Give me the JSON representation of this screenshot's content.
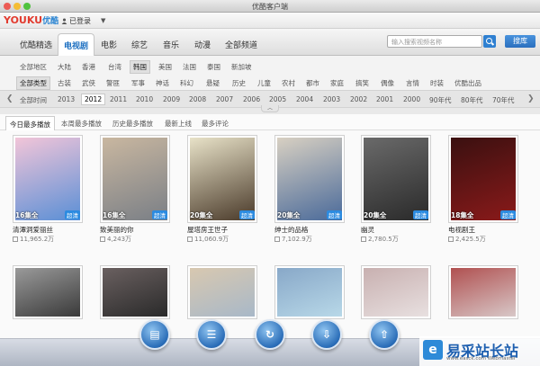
{
  "window": {
    "title": "优酷客户端"
  },
  "topbar": {
    "logo_you": "YOUKU",
    "logo_ku": "优酷",
    "login": "已登录",
    "caret": "▼"
  },
  "nav": {
    "items": [
      "优酷精选",
      "电视剧",
      "电影",
      "综艺",
      "音乐",
      "动漫",
      "全部频道"
    ],
    "active_index": 1,
    "search_placeholder": "输入搜索视频名称",
    "library_label": "搜库"
  },
  "filters": {
    "region": {
      "items": [
        "全部地区",
        "大陆",
        "香港",
        "台湾",
        "韩国",
        "美国",
        "法国",
        "泰国",
        "新加坡"
      ],
      "selected": 4
    },
    "genre": {
      "items": [
        "全部类型",
        "古装",
        "武侠",
        "警匪",
        "军事",
        "神话",
        "科幻",
        "悬疑",
        "历史",
        "儿童",
        "农村",
        "都市",
        "家庭",
        "搞笑",
        "偶像",
        "言情",
        "时装",
        "优酷出品"
      ],
      "selected": 0
    },
    "year": {
      "items": [
        "全部时间",
        "2013",
        "2012",
        "2011",
        "2010",
        "2009",
        "2008",
        "2007",
        "2006",
        "2005",
        "2004",
        "2003",
        "2002",
        "2001",
        "2000",
        "90年代",
        "80年代",
        "70年代"
      ],
      "selected": 2
    },
    "prev": "❮",
    "next": "❯",
    "collapse": "︿"
  },
  "sort_tabs": {
    "items": [
      "今日最多播放",
      "本周最多播放",
      "历史最多播放",
      "最新上线",
      "最多评论"
    ],
    "active_index": 0
  },
  "hd_label": "超清",
  "cards": [
    {
      "title": "清潭洞爱丽丝",
      "episodes": "16集全",
      "plays": "11,965.2万",
      "color1": "#5a8fd6",
      "color2": "#f2c5d8"
    },
    {
      "title": "致美丽的你",
      "episodes": "16集全",
      "plays": "4,243万",
      "color1": "#7a7f86",
      "color2": "#c9b7a0"
    },
    {
      "title": "屋塔房王世子",
      "episodes": "20集全",
      "plays": "11,060.9万",
      "color1": "#4a3a2a",
      "color2": "#e8e2c8"
    },
    {
      "title": "绅士的品格",
      "episodes": "20集全",
      "plays": "7,102.9万",
      "color1": "#4a6a9a",
      "color2": "#d8d0c2"
    },
    {
      "title": "幽灵",
      "episodes": "20集全",
      "plays": "2,780.5万",
      "color1": "#2a2a2a",
      "color2": "#6a6a6a"
    },
    {
      "title": "电视剧王",
      "episodes": "18集全",
      "plays": "2,425.5万",
      "color1": "#8a1a1a",
      "color2": "#3a1010"
    }
  ],
  "row2_colors": [
    [
      "#3a3a3a",
      "#9a9a9a"
    ],
    [
      "#2a2a2a",
      "#6a6060"
    ],
    [
      "#a8b8c8",
      "#d8c8b0"
    ],
    [
      "#b8d8e8",
      "#88a8c8"
    ],
    [
      "#e8e0e0",
      "#c8b0b0"
    ],
    [
      "#d8c8c8",
      "#b05050"
    ]
  ],
  "dock": {
    "icons": [
      "film-icon",
      "list-icon",
      "refresh-icon",
      "download-icon",
      "upload-icon"
    ]
  },
  "watermark": {
    "logo": "e",
    "text": "易采站长站",
    "sub": "www.easck.com Webmaster"
  }
}
